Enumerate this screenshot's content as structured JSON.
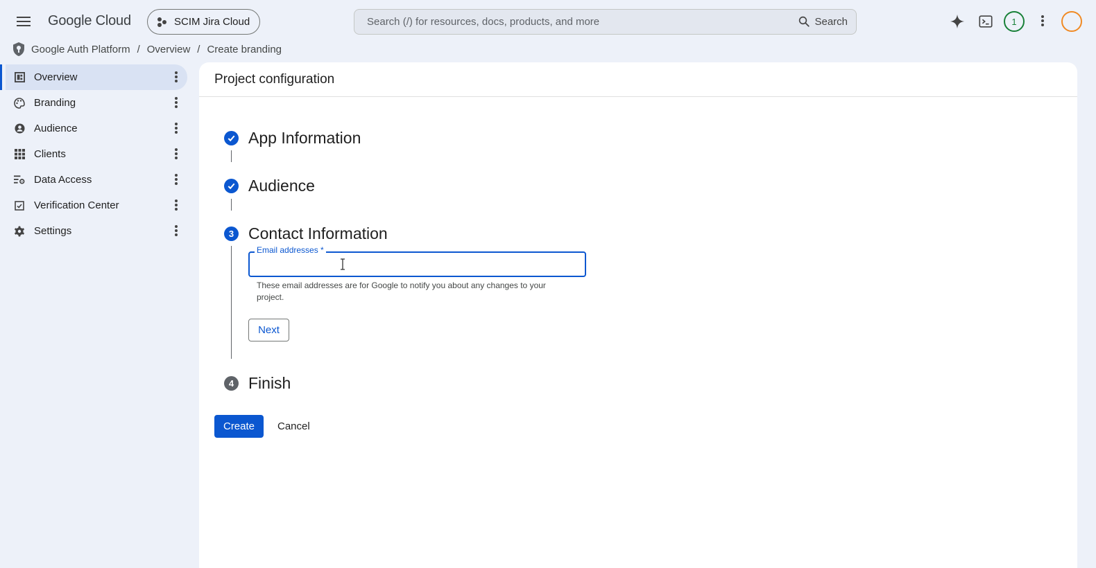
{
  "header": {
    "logo": "Google Cloud",
    "project": "SCIM Jira Cloud",
    "search_placeholder": "Search (/) for resources, docs, products, and more",
    "search_button": "Search",
    "notification_count": "1"
  },
  "breadcrumb": {
    "items": [
      "Google Auth Platform",
      "Overview",
      "Create branding"
    ],
    "separator": "/"
  },
  "sidebar": {
    "items": [
      {
        "label": "Overview",
        "icon": "dashboard-icon",
        "active": true
      },
      {
        "label": "Branding",
        "icon": "palette-icon"
      },
      {
        "label": "Audience",
        "icon": "person-icon"
      },
      {
        "label": "Clients",
        "icon": "grid-icon"
      },
      {
        "label": "Data Access",
        "icon": "data-access-icon"
      },
      {
        "label": "Verification Center",
        "icon": "verification-icon"
      },
      {
        "label": "Settings",
        "icon": "gear-icon"
      }
    ]
  },
  "main": {
    "title": "Project configuration",
    "steps": [
      {
        "number": "1",
        "label": "App Information",
        "state": "done"
      },
      {
        "number": "2",
        "label": "Audience",
        "state": "done"
      },
      {
        "number": "3",
        "label": "Contact Information",
        "state": "current"
      },
      {
        "number": "4",
        "label": "Finish",
        "state": "todo"
      }
    ],
    "email_field": {
      "label": "Email addresses *",
      "value": "",
      "helper": "These email addresses are for Google to notify you about any changes to your project."
    },
    "next_button": "Next",
    "create_button": "Create",
    "cancel_button": "Cancel"
  },
  "colors": {
    "accent": "#0b57d0",
    "page_background": "#edf1f9",
    "success": "#188038",
    "avatar_ring": "#f08a24"
  }
}
